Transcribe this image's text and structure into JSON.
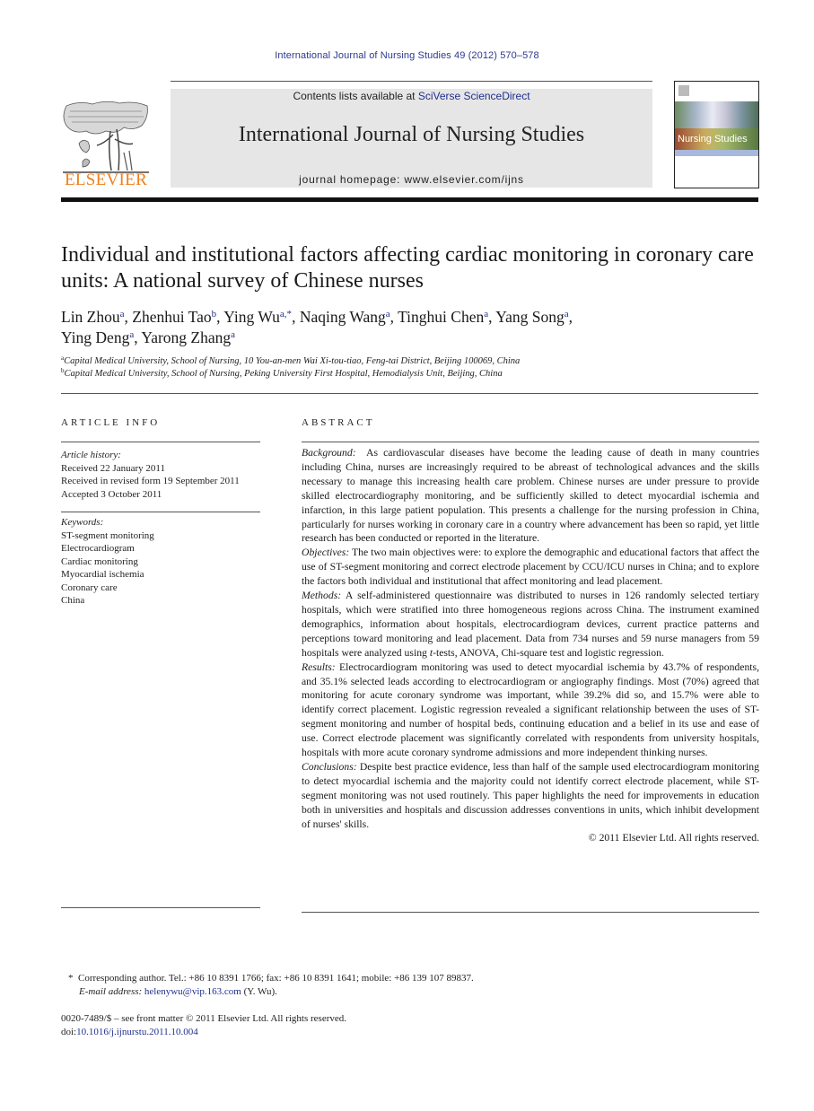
{
  "running_head": "International Journal of Nursing Studies 49 (2012) 570–578",
  "masthead": {
    "publisher_logo": "ELSEVIER",
    "publisher_logo_icon": "elsevier-tree-icon",
    "contents_prefix": "Contents lists available at ",
    "contents_link": "SciVerse ScienceDirect",
    "journal_title": "International Journal of Nursing Studies",
    "homepage_prefix": "journal homepage: ",
    "homepage_url": "www.elsevier.com/ijns",
    "cover_title": "Nursing Studies",
    "accent_color": "#f07f1b",
    "link_color": "#1f2f8c"
  },
  "article": {
    "title": "Individual and institutional factors affecting cardiac monitoring in coronary care units: A national survey of Chinese nurses",
    "authors": [
      {
        "name": "Lin Zhou",
        "sup": "a",
        "sep": ", "
      },
      {
        "name": "Zhenhui Tao",
        "sup": "b",
        "sep": ", "
      },
      {
        "name": "Ying Wu",
        "sup": "a,*",
        "sep": ", "
      },
      {
        "name": "Naqing Wang",
        "sup": "a",
        "sep": ", "
      },
      {
        "name": "Tinghui Chen",
        "sup": "a",
        "sep": ", "
      },
      {
        "name": "Yang Song",
        "sup": "a",
        "sep": ","
      },
      {
        "name": "Ying Deng",
        "sup": "a",
        "sep": ", "
      },
      {
        "name": "Yarong Zhang",
        "sup": "a",
        "sep": ""
      }
    ],
    "affiliations": [
      {
        "mark": "a",
        "text": "Capital Medical University, School of Nursing, 10 You-an-men Wai Xi-tou-tiao, Feng-tai District, Beijing 100069, China"
      },
      {
        "mark": "b",
        "text": "Capital Medical University, School of Nursing, Peking University First Hospital, Hemodialysis Unit, Beijing, China"
      }
    ]
  },
  "article_info": {
    "heading": "ARTICLE INFO",
    "history_label": "Article history:",
    "history": [
      "Received 22 January 2011",
      "Received in revised form 19 September 2011",
      "Accepted 3 October 2011"
    ],
    "keywords_label": "Keywords:",
    "keywords": [
      "ST-segment monitoring",
      "Electrocardiogram",
      "Cardiac monitoring",
      "Myocardial ischemia",
      "Coronary care",
      "China"
    ]
  },
  "abstract": {
    "heading": "ABSTRACT",
    "sections": [
      {
        "label": "Background:",
        "text": "As cardiovascular diseases have become the leading cause of death in many countries including China, nurses are increasingly required to be abreast of technological advances and the skills necessary to manage this increasing health care problem. Chinese nurses are under pressure to provide skilled electrocardiography monitoring, and be sufficiently skilled to detect myocardial ischemia and infarction, in this large patient population. This presents a challenge for the nursing profession in China, particularly for nurses working in coronary care in a country where advancement has been so rapid, yet little research has been conducted or reported in the literature."
      },
      {
        "label": "Objectives:",
        "text": "The two main objectives were: to explore the demographic and educational factors that affect the use of ST-segment monitoring and correct electrode placement by CCU/ICU nurses in China; and to explore the factors both individual and institutional that affect monitoring and lead placement."
      },
      {
        "label": "Methods:",
        "text_before_italic": "A self-administered questionnaire was distributed to nurses in 126 randomly selected tertiary hospitals, which were stratified into three homogeneous regions across China. The instrument examined demographics, information about hospitals, electrocardiogram devices, current practice patterns and perceptions toward monitoring and lead placement. Data from 734 nurses and 59 nurse managers from 59 hospitals were analyzed using ",
        "italic": "t",
        "text_after_italic": "-tests, ANOVA, Chi-square test and logistic regression."
      },
      {
        "label": "Results:",
        "text": "Electrocardiogram monitoring was used to detect myocardial ischemia by 43.7% of respondents, and 35.1% selected leads according to electrocardiogram or angiography findings. Most (70%) agreed that monitoring for acute coronary syndrome was important, while 39.2% did so, and 15.7% were able to identify correct placement. Logistic regression revealed a significant relationship between the uses of ST-segment monitoring and number of hospital beds, continuing education and a belief in its use and ease of use. Correct electrode placement was significantly correlated with respondents from university hospitals, hospitals with more acute coronary syndrome admissions and more independent thinking nurses."
      },
      {
        "label": "Conclusions:",
        "text": "Despite best practice evidence, less than half of the sample used electrocardiogram monitoring to detect myocardial ischemia and the majority could not identify correct electrode placement, while ST-segment monitoring was not used routinely. This paper highlights the need for improvements in education both in universities and hospitals and discussion addresses conventions in units, which inhibit development of nurses' skills."
      }
    ],
    "copyright": "© 2011 Elsevier Ltd. All rights reserved."
  },
  "footnotes": {
    "corresponding_mark": "*",
    "corresponding": "Corresponding author. Tel.: +86 10 8391 1766; fax: +86 10 8391 1641; mobile: +86 139 107 89837.",
    "email_label": "E-mail address:",
    "email": "helenywu@vip.163.com",
    "email_suffix": " (Y. Wu).",
    "issn_line": "0020-7489/$ – see front matter © 2011 Elsevier Ltd. All rights reserved.",
    "doi_prefix": "doi:",
    "doi": "10.1016/j.ijnurstu.2011.10.004"
  }
}
